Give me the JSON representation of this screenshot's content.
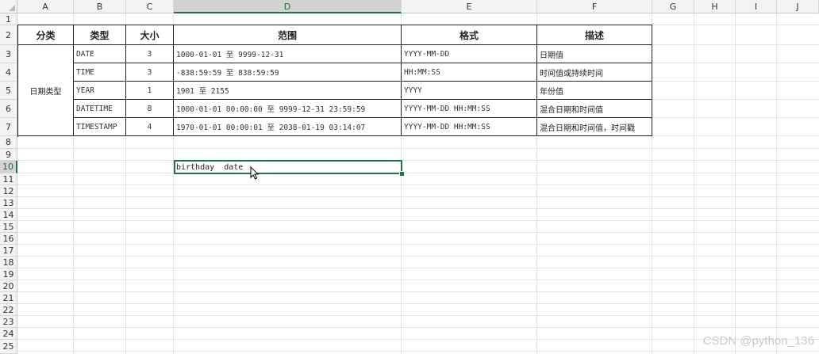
{
  "columns": [
    "A",
    "B",
    "C",
    "D",
    "E",
    "F",
    "G",
    "H",
    "I",
    "J"
  ],
  "rows": [
    "1",
    "2",
    "3",
    "4",
    "5",
    "6",
    "7",
    "8",
    "9",
    "10",
    "11",
    "12",
    "13",
    "14",
    "15",
    "16",
    "17",
    "18",
    "19",
    "20",
    "21",
    "22",
    "23",
    "24",
    "25"
  ],
  "table": {
    "headers": [
      "分类",
      "类型",
      "大小",
      "范围",
      "格式",
      "描述"
    ],
    "category": "日期类型",
    "data": [
      {
        "type": "DATE",
        "size": "3",
        "range": "1000-01-01 至 9999-12-31",
        "format": "YYYY-MM-DD",
        "desc": "日期值"
      },
      {
        "type": "TIME",
        "size": "3",
        "range": "-838:59:59 至 838:59:59",
        "format": "HH:MM:SS",
        "desc": "时间值或持续时间"
      },
      {
        "type": "YEAR",
        "size": "1",
        "range": "1901 至 2155",
        "format": "YYYY",
        "desc": "年份值"
      },
      {
        "type": "DATETIME",
        "size": "8",
        "range": "1000-01-01 00:00:00 至 9999-12-31 23:59:59",
        "format": "YYYY-MM-DD HH:MM:SS",
        "desc": "混合日期和时间值"
      },
      {
        "type": "TIMESTAMP",
        "size": "4",
        "range": "1970-01-01 00:00:01 至 2038-01-19 03:14:07",
        "format": "YYYY-MM-DD HH:MM:SS",
        "desc": "混合日期和时间值，时间戳"
      }
    ]
  },
  "active_cell": {
    "address": "D10",
    "value": "birthday  date"
  },
  "watermark": "CSDN @python_136",
  "colors": {
    "accent": "#217346",
    "header_bg": "#f3f3f3",
    "selected_header_bg": "#d2d2d2"
  }
}
